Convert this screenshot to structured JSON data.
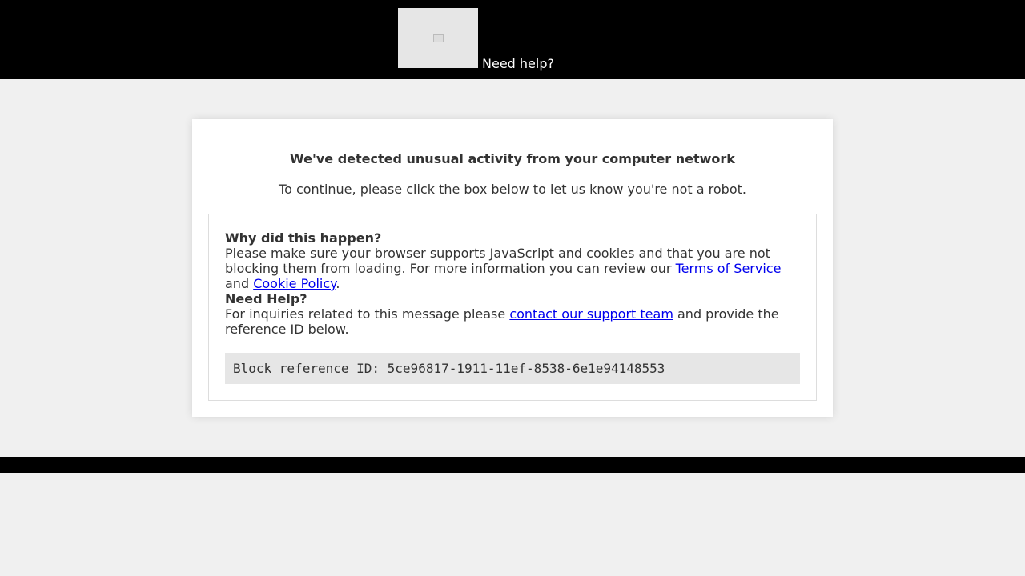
{
  "header": {
    "help_link": "Need help?",
    "logo_icon": "broken-image-icon"
  },
  "card": {
    "title": "We've detected unusual activity from your computer network",
    "subtitle": "To continue, please click the box below to let us know you're not a robot.",
    "why_heading": "Why did this happen?",
    "why_text_1": "Please make sure your browser supports JavaScript and cookies and that you are not blocking them from loading. For more information you can review our ",
    "terms_link": "Terms of Service",
    "why_text_2": " and ",
    "cookie_link": "Cookie Policy",
    "why_text_3": ".",
    "help_heading": "Need Help?",
    "help_text_1": "For inquiries related to this message please ",
    "support_link": "contact our support team",
    "help_text_2": " and provide the reference ID below.",
    "reference": "Block reference ID: 5ce96817-1911-11ef-8538-6e1e94148553"
  }
}
